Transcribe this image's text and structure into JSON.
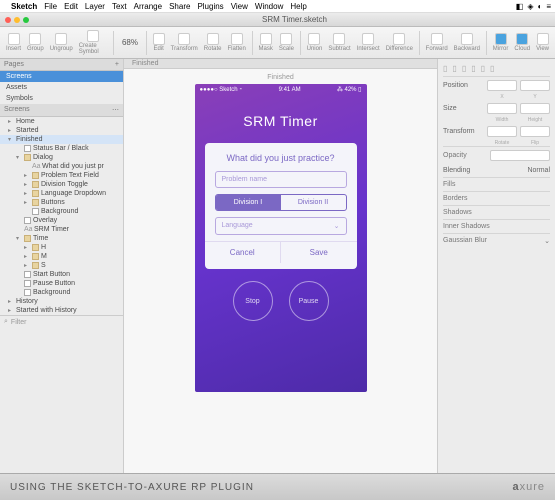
{
  "menubar": {
    "app": "Sketch",
    "items": [
      "File",
      "Edit",
      "Layer",
      "Text",
      "Arrange",
      "Share",
      "Plugins",
      "View",
      "Window",
      "Help"
    ]
  },
  "window": {
    "title": "SRM Timer.sketch"
  },
  "toolbar": {
    "items": [
      "Insert",
      "Group",
      "Ungroup",
      "Create Symbol",
      "",
      "Edit",
      "Transform",
      "Rotate",
      "Flatten",
      "Mask",
      "Scale",
      "Union",
      "Subtract",
      "Intersect",
      "Difference",
      "Forward",
      "Backward",
      "Mirror",
      "Cloud",
      "View"
    ],
    "zoom": "68%"
  },
  "pages": {
    "hdr": "Pages",
    "items": [
      "Screens",
      "Assets",
      "Symbols"
    ]
  },
  "layers": {
    "hdr": "Screens",
    "tree": [
      {
        "d": 0,
        "tri": "▸",
        "label": "Home"
      },
      {
        "d": 0,
        "tri": "▸",
        "label": "Started"
      },
      {
        "d": 0,
        "tri": "▾",
        "label": "Finished",
        "sel": true
      },
      {
        "d": 1,
        "tri": "",
        "ico": "r",
        "label": "Status Bar / Black"
      },
      {
        "d": 1,
        "tri": "▾",
        "ico": "f",
        "label": "Dialog"
      },
      {
        "d": 2,
        "tri": "",
        "ico": "t",
        "label": "What did you just pr"
      },
      {
        "d": 2,
        "tri": "▸",
        "ico": "f",
        "label": "Problem Text Field"
      },
      {
        "d": 2,
        "tri": "▸",
        "ico": "f",
        "label": "Division Toggle"
      },
      {
        "d": 2,
        "tri": "▸",
        "ico": "f",
        "label": "Language Dropdown"
      },
      {
        "d": 2,
        "tri": "▸",
        "ico": "f",
        "label": "Buttons"
      },
      {
        "d": 2,
        "tri": "",
        "ico": "r",
        "label": "Background"
      },
      {
        "d": 1,
        "tri": "",
        "ico": "r",
        "label": "Overlay"
      },
      {
        "d": 1,
        "tri": "",
        "ico": "t",
        "label": "SRM Timer",
        "pre": "Aa"
      },
      {
        "d": 1,
        "tri": "▾",
        "ico": "f",
        "label": "Time"
      },
      {
        "d": 2,
        "tri": "▸",
        "ico": "f",
        "label": "H"
      },
      {
        "d": 2,
        "tri": "▸",
        "ico": "f",
        "label": "M"
      },
      {
        "d": 2,
        "tri": "▸",
        "ico": "f",
        "label": "S"
      },
      {
        "d": 1,
        "tri": "",
        "ico": "r",
        "label": "Start Button"
      },
      {
        "d": 1,
        "tri": "",
        "ico": "r",
        "label": "Pause Button"
      },
      {
        "d": 1,
        "tri": "",
        "ico": "r",
        "label": "Background"
      },
      {
        "d": 0,
        "tri": "▸",
        "label": "History"
      },
      {
        "d": 0,
        "tri": "▸",
        "label": "Started with History"
      }
    ],
    "filter": "Filter"
  },
  "canvas": {
    "tab": "Finished",
    "artlabel": "Finished",
    "statusbar": {
      "left": "●●●●○ Sketch ⁃",
      "time": "9:41 AM",
      "right": "⁂ 42% ▯"
    },
    "title": "SRM Timer",
    "dialog": {
      "heading": "What did you just practice?",
      "problem_ph": "Problem name",
      "div1": "Division I",
      "div2": "Division II",
      "lang": "Language",
      "chev": "⌄",
      "cancel": "Cancel",
      "save": "Save"
    },
    "stop": "Stop",
    "pause": "Pause"
  },
  "inspector": {
    "position": "Position",
    "size": "Size",
    "width": "Width",
    "height": "Height",
    "transform": "Transform",
    "rotate": "Rotate",
    "flip": "Flip",
    "opacity": "Opacity",
    "blending": "Blending",
    "blend_val": "Normal",
    "sections": [
      "Fills",
      "Borders",
      "Shadows",
      "Inner Shadows",
      "Gaussian Blur"
    ]
  },
  "caption": {
    "text": "USING THE SKETCH-TO-AXURE RP PLUGIN",
    "logo_a": "a",
    "logo_b": "xure"
  }
}
